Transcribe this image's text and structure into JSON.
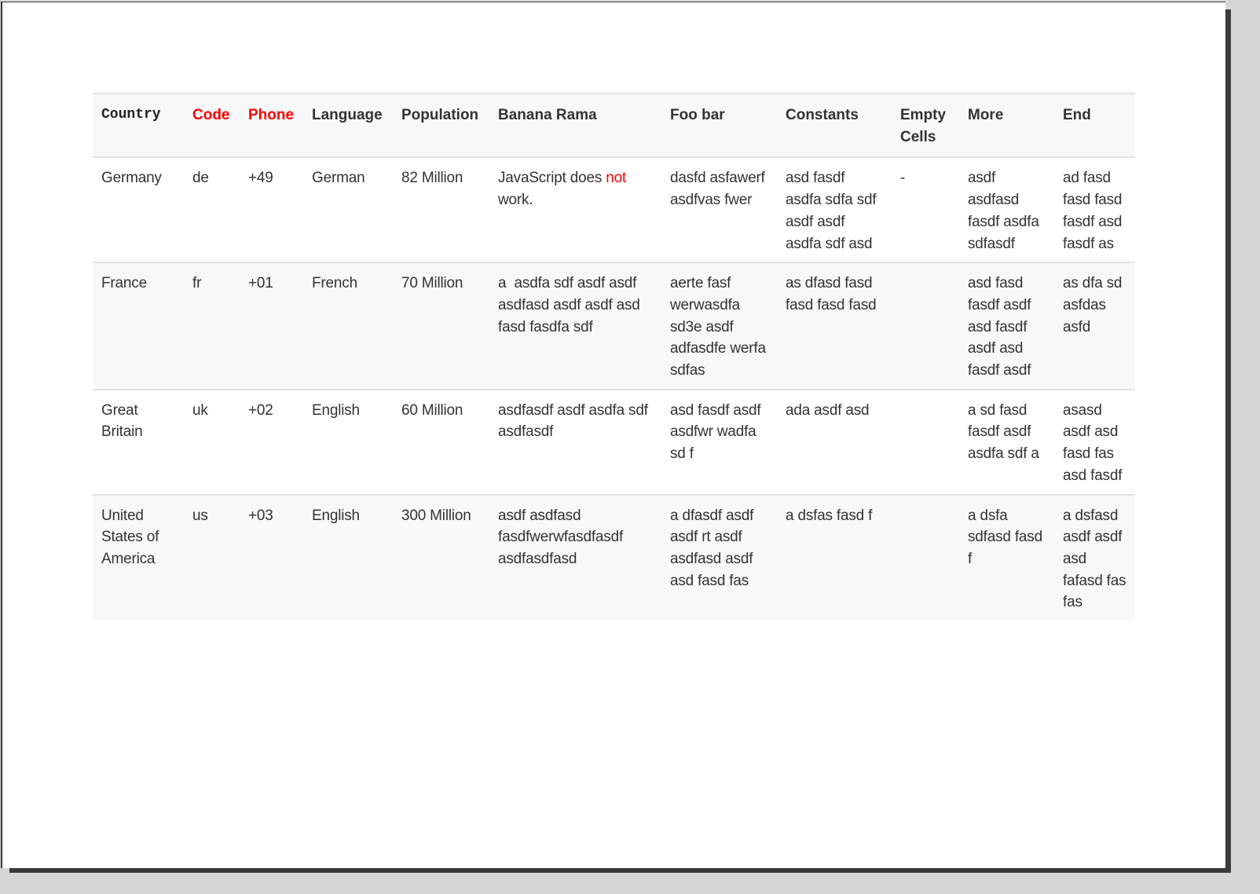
{
  "colors": {
    "accent_red": "#ff0000",
    "text": "#333333",
    "stripe": "#f8f8f8",
    "rule": "#e2e2e2"
  },
  "table": {
    "headers": [
      {
        "label": "Country",
        "style": "monospace"
      },
      {
        "label": "Code",
        "style": "red"
      },
      {
        "label": "Phone",
        "style": "red"
      },
      {
        "label": "Language",
        "style": "normal"
      },
      {
        "label": "Population",
        "style": "normal"
      },
      {
        "label": "Banana Rama",
        "style": "normal"
      },
      {
        "label": "Foo bar",
        "style": "normal"
      },
      {
        "label": "Constants",
        "style": "normal"
      },
      {
        "label": "Empty Cells",
        "style": "normal"
      },
      {
        "label": "More",
        "style": "normal"
      },
      {
        "label": "End",
        "style": "normal"
      }
    ],
    "rows": [
      {
        "country": "Germany",
        "code": "de",
        "phone": "+49",
        "language": "German",
        "population": "82 Million",
        "banana_rama": {
          "before": "JavaScript does ",
          "highlight": "not",
          "after": " work."
        },
        "foo_bar": "dasfd asfawerf asdfvas fwer",
        "constants": "asd fasdf asdfa sdfa sdf asdf asdf asdfa sdf asd",
        "empty_cells": "-",
        "more": "asdf asdfasd fasdf asdfa sdfasdf",
        "end": "ad fasd fasd fasd fasdf asd fasdf as"
      },
      {
        "country": "France",
        "code": "fr",
        "phone": "+01",
        "language": "French",
        "population": "70 Million",
        "banana_rama": {
          "before": "a  asdfa sdf asdf asdf asdfasd asdf asdf asd fasd fasdfa sdf",
          "highlight": "",
          "after": ""
        },
        "foo_bar": "aerte fasf werwasdfa sd3e asdf adfasdfe werfa sdfas",
        "constants": "as dfasd fasd fasd fasd fasd",
        "empty_cells": "",
        "more": "asd fasd fasdf asdf asd fasdf asdf asd fasdf asdf",
        "end": "as dfa sd asfdas asfd"
      },
      {
        "country": "Great Britain",
        "code": "uk",
        "phone": "+02",
        "language": "English",
        "population": "60 Million",
        "banana_rama": {
          "before": "asdfasdf asdf asdfa sdf asdfasdf",
          "highlight": "",
          "after": ""
        },
        "foo_bar": "asd fasdf asdf asdfwr wadfa sd f",
        "constants": "ada asdf asd",
        "empty_cells": "",
        "more": "a sd fasd fasdf asdf asdfa sdf a",
        "end": "asasd asdf asd fasd fas asd fasdf"
      },
      {
        "country": "United States of America",
        "code": "us",
        "phone": "+03",
        "language": "English",
        "population": "300 Million",
        "banana_rama": {
          "before": "asdf asdfasd fasdfwerwfasdfasdf asdfasdfasd",
          "highlight": "",
          "after": ""
        },
        "foo_bar": "a dfasdf asdf asdf rt asdf asdfasd asdf asd fasd fas",
        "constants": "a dsfas fasd f",
        "empty_cells": "",
        "more": "a dsfa sdfasd fasd f",
        "end": "a dsfasd asdf asdf asd fafasd fas fas"
      }
    ]
  }
}
